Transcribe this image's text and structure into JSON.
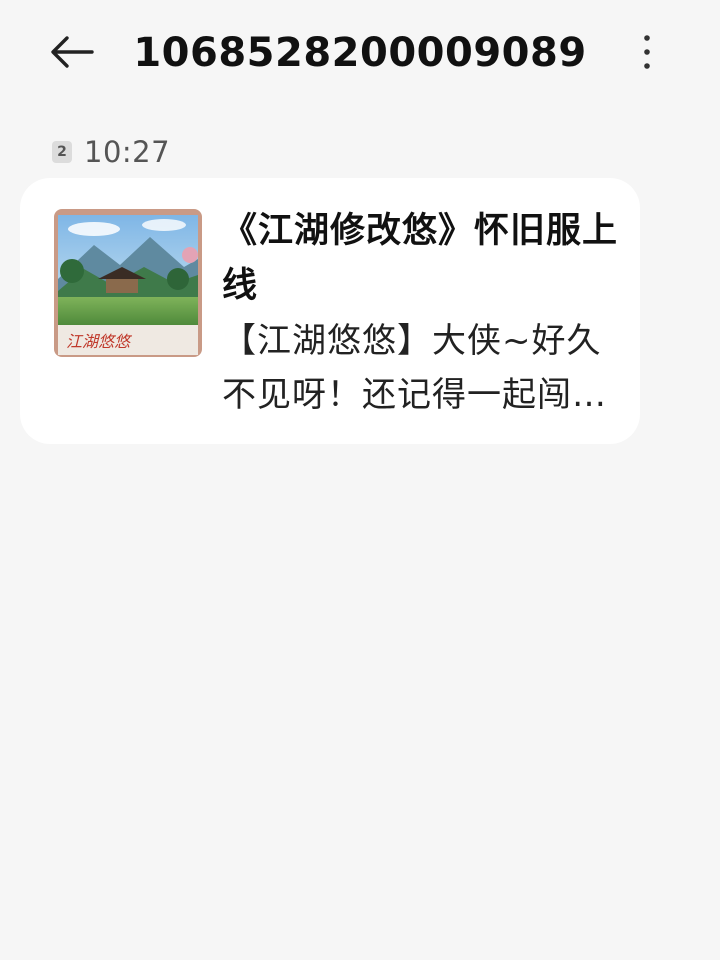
{
  "header": {
    "back_icon": "arrow-left-icon",
    "title": "1068528200009089",
    "more_icon": "more-vertical-icon"
  },
  "message": {
    "sim_slot": "2",
    "time": "10:27",
    "card": {
      "thumbnail_caption": "江湖悠悠",
      "title": "《江湖修改悠》怀旧服上线",
      "body": "【江湖悠悠】大侠~好久不见呀！还记得一起闯荡江湖的日子吗"
    }
  },
  "colors": {
    "background": "#f6f6f6",
    "bubble": "#ffffff",
    "text_primary": "#111111",
    "text_secondary": "#555555"
  }
}
